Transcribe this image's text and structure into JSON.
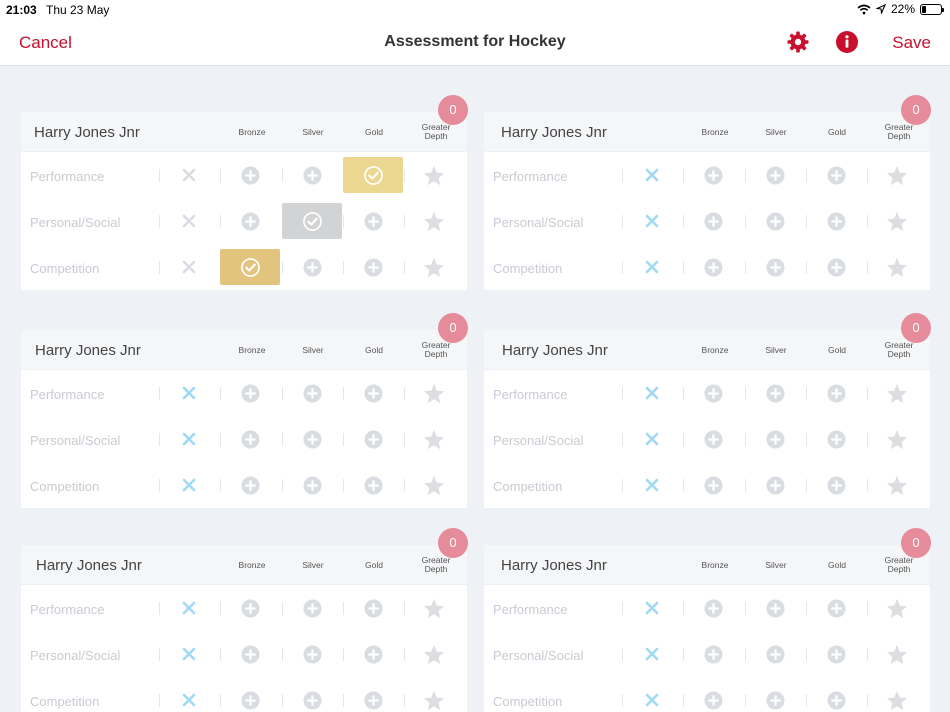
{
  "status_bar": {
    "time": "21:03",
    "date": "Thu 23 May",
    "battery": "22%"
  },
  "nav": {
    "cancel": "Cancel",
    "title": "Assessment for Hockey",
    "save": "Save"
  },
  "columns": {
    "bronze": "Bronze",
    "silver": "Silver",
    "gold": "Gold",
    "greater_line1": "Greater",
    "greater_line2": "Depth"
  },
  "rows": [
    "Performance",
    "Personal/Social",
    "Competition"
  ],
  "colors": {
    "accent": "#c8102e",
    "badge": "#e58b99",
    "gold_selected": "#ecd790",
    "bronze_selected": "#e3c47e",
    "silver_selected": "#d2d3d5",
    "cross_active": "#9fd9f3",
    "cross_inactive": "#d9dce1",
    "plus": "#d9dce1",
    "star": "#dcdee2"
  },
  "cards": [
    {
      "name": "Harry Jones Jnr",
      "badge": "0",
      "rows": [
        {
          "label": "Performance",
          "selected": "gold"
        },
        {
          "label": "Personal/Social",
          "selected": "silver"
        },
        {
          "label": "Competition",
          "selected": "bronze"
        }
      ]
    },
    {
      "name": "Harry Jones Jnr",
      "badge": "0",
      "rows": [
        {
          "label": "Performance",
          "selected": "none"
        },
        {
          "label": "Personal/Social",
          "selected": "none"
        },
        {
          "label": "Competition",
          "selected": "none"
        }
      ]
    },
    {
      "name": "Harry Jones Jnr",
      "badge": "0",
      "rows": [
        {
          "label": "Performance",
          "selected": "none"
        },
        {
          "label": "Personal/Social",
          "selected": "none"
        },
        {
          "label": "Competition",
          "selected": "none"
        }
      ]
    },
    {
      "name": "Harry Jones Jnr",
      "badge": "0",
      "rows": [
        {
          "label": "Performance",
          "selected": "none"
        },
        {
          "label": "Personal/Social",
          "selected": "none"
        },
        {
          "label": "Competition",
          "selected": "none"
        }
      ]
    },
    {
      "name": "Harry Jones Jnr",
      "badge": "0",
      "rows": [
        {
          "label": "Performance",
          "selected": "none"
        },
        {
          "label": "Personal/Social",
          "selected": "none"
        },
        {
          "label": "Competition",
          "selected": "none"
        }
      ]
    },
    {
      "name": "Harry Jones Jnr",
      "badge": "0",
      "rows": [
        {
          "label": "Performance",
          "selected": "none"
        },
        {
          "label": "Personal/Social",
          "selected": "none"
        },
        {
          "label": "Competition",
          "selected": "none"
        }
      ]
    }
  ],
  "icons": {
    "gear": "gear-icon",
    "info": "info-icon",
    "cross": "cross-icon",
    "plus": "plus-circle-icon",
    "check": "check-circle-icon",
    "star": "star-icon",
    "wifi": "wifi-icon",
    "location": "location-arrow-icon",
    "battery": "battery-icon"
  }
}
